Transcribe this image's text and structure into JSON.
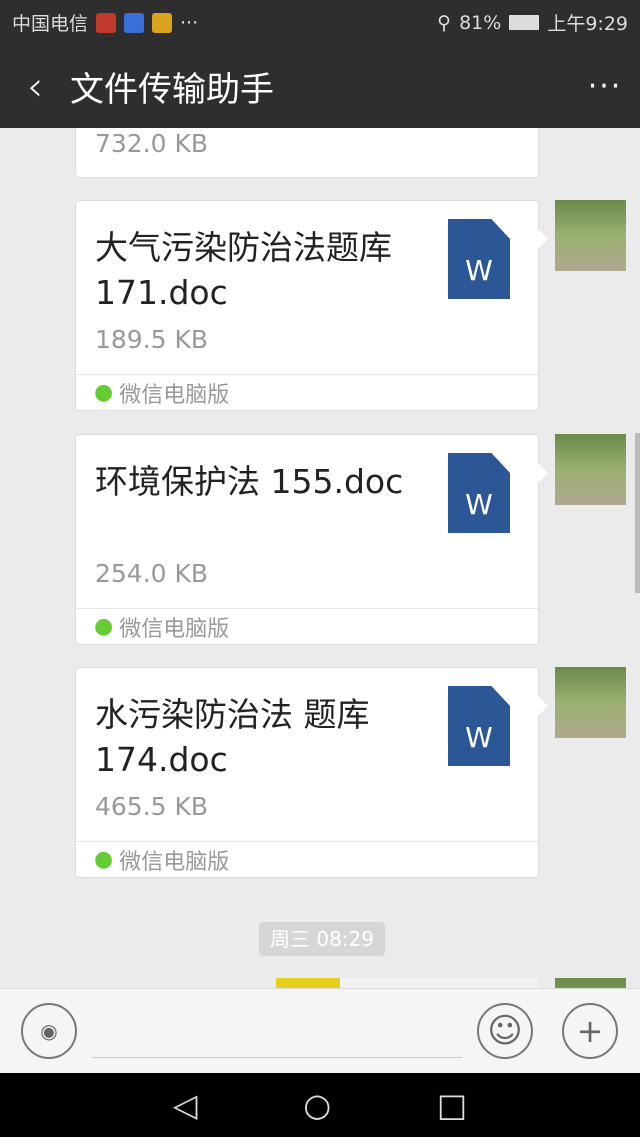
{
  "status": {
    "carrier": "中国电信",
    "battery": "81%",
    "time": "上午9:29",
    "more": "···"
  },
  "header": {
    "title": "文件传输助手",
    "back": "‹",
    "more": "···"
  },
  "messages": [
    {
      "name": "",
      "size": "732.0 KB",
      "source": ""
    },
    {
      "name": "大气污染防治法题库171.doc",
      "size": "189.5 KB",
      "source": "微信电脑版"
    },
    {
      "name": "环境保护法 155.doc",
      "size": "254.0 KB",
      "source": "微信电脑版"
    },
    {
      "name": "水污染防治法 题库174.doc",
      "size": "465.5 KB",
      "source": "微信电脑版"
    }
  ],
  "file_icon_letter": "W",
  "timestamp": "周三 08:29",
  "colors": {
    "bar": "#2e2e2e",
    "word": "#2b5797"
  }
}
